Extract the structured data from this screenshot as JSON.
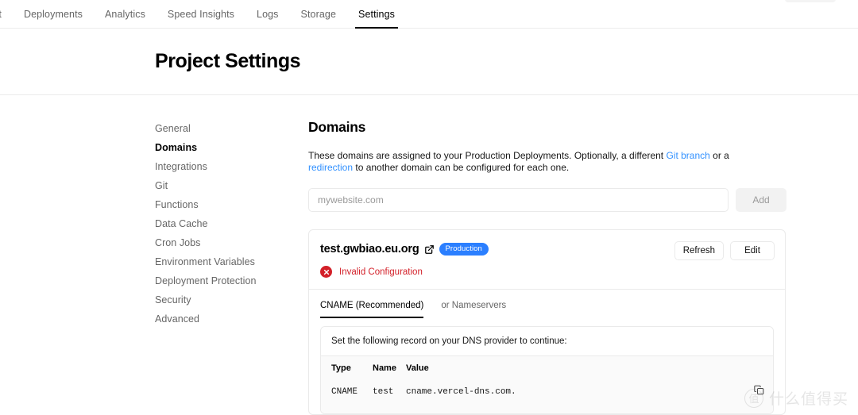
{
  "topnav": {
    "tabs": [
      {
        "label": "ct",
        "active": false
      },
      {
        "label": "Deployments",
        "active": false
      },
      {
        "label": "Analytics",
        "active": false
      },
      {
        "label": "Speed Insights",
        "active": false
      },
      {
        "label": "Logs",
        "active": false
      },
      {
        "label": "Storage",
        "active": false
      },
      {
        "label": "Settings",
        "active": true
      }
    ]
  },
  "header": {
    "title": "Project Settings"
  },
  "sidebar": {
    "items": [
      {
        "label": "General",
        "active": false
      },
      {
        "label": "Domains",
        "active": true
      },
      {
        "label": "Integrations",
        "active": false
      },
      {
        "label": "Git",
        "active": false
      },
      {
        "label": "Functions",
        "active": false
      },
      {
        "label": "Data Cache",
        "active": false
      },
      {
        "label": "Cron Jobs",
        "active": false
      },
      {
        "label": "Environment Variables",
        "active": false
      },
      {
        "label": "Deployment Protection",
        "active": false
      },
      {
        "label": "Security",
        "active": false
      },
      {
        "label": "Advanced",
        "active": false
      }
    ]
  },
  "main": {
    "title": "Domains",
    "description": {
      "part1": "These domains are assigned to your Production Deployments. Optionally, a different ",
      "link1": "Git branch",
      "part2": " or a ",
      "link2": "redirection",
      "part3": " to another domain can be configured for each one."
    },
    "add_form": {
      "placeholder": "mywebsite.com",
      "value": "",
      "button_label": "Add"
    },
    "domain_card": {
      "name": "test.gwbiao.eu.org",
      "external_link_icon": "external-link-icon",
      "badge": "Production",
      "status": {
        "icon": "error-circle-icon",
        "text": "Invalid Configuration",
        "color": "#d32029"
      },
      "actions": {
        "refresh_label": "Refresh",
        "edit_label": "Edit"
      },
      "tabs": [
        {
          "label": "CNAME (Recommended)",
          "active": true
        },
        {
          "label": "or Nameservers",
          "active": false
        }
      ],
      "dns": {
        "instruction": "Set the following record on your DNS provider to continue:",
        "columns": [
          "Type",
          "Name",
          "Value"
        ],
        "rows": [
          {
            "type": "CNAME",
            "name": "test",
            "value": "cname.vercel-dns.com."
          }
        ],
        "copy_icon": "copy-icon"
      }
    }
  },
  "watermark": {
    "logo_glyph": "值",
    "text": "什么值得买"
  },
  "colors": {
    "accent_blue": "#2b7fff",
    "link_blue": "#3291ff",
    "error_red": "#d32029",
    "border": "#eaeaea"
  }
}
